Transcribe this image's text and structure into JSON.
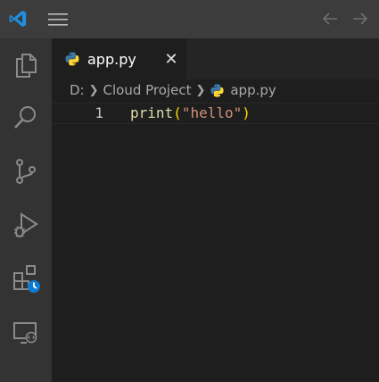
{
  "colors": {
    "accent": "#0078d4",
    "titlebar": "#3c3c3c",
    "activitybar": "#333333",
    "editor_bg": "#1e1e1e",
    "tab_inactive_bg": "#252526"
  },
  "titlebar": {
    "logo_icon": "vscode-logo-icon",
    "menu_icon": "hamburger-menu-icon",
    "nav": [
      "arrow-left-icon",
      "arrow-right-icon"
    ]
  },
  "activitybar": {
    "items": [
      {
        "name": "explorer",
        "icon": "files-icon"
      },
      {
        "name": "search",
        "icon": "search-icon"
      },
      {
        "name": "source-control",
        "icon": "source-control-icon"
      },
      {
        "name": "run-and-debug",
        "icon": "run-debug-icon"
      },
      {
        "name": "extensions",
        "icon": "extensions-update-icon"
      },
      {
        "name": "remote-explorer",
        "icon": "remote-explorer-icon"
      }
    ]
  },
  "tabs": [
    {
      "label": "app.py",
      "icon": "python-icon",
      "active": true
    }
  ],
  "breadcrumb": {
    "drive": "D:",
    "folder": "Cloud Project",
    "file": "app.py"
  },
  "editor": {
    "lines": [
      {
        "number": "1",
        "tokens": {
          "fn": "print",
          "open": "(",
          "str": "\"hello\"",
          "close": ")"
        }
      }
    ]
  }
}
